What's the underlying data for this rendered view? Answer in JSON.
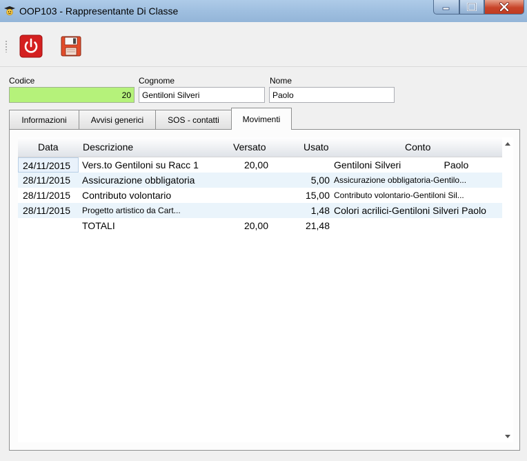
{
  "window": {
    "title": "OOP103 - Rappresentante Di Classe"
  },
  "icons": {
    "app": "graduate-icon",
    "exit": "power-icon",
    "save": "floppy-disk-icon"
  },
  "colors": {
    "codice_bg": "#b5f27a",
    "power_red": "#d42020",
    "row_alt": "#eaf4fb"
  },
  "form": {
    "codice_label": "Codice",
    "codice_value": "20",
    "cognome_label": "Cognome",
    "cognome_value": "Gentiloni Silveri",
    "nome_label": "Nome",
    "nome_value": "Paolo"
  },
  "tabs": [
    {
      "label": "Informazioni"
    },
    {
      "label": "Avvisi generici"
    },
    {
      "label": "SOS - contatti"
    },
    {
      "label": "Movimenti",
      "selected": true
    }
  ],
  "table": {
    "columns": [
      "Data",
      "Descrizione",
      "Versato",
      "Usato",
      "Conto"
    ],
    "rows": [
      {
        "data": "24/11/2015",
        "descrizione": "Vers.to Gentiloni  su Racc 1",
        "versato": "20,00",
        "usato": "",
        "conto": "Gentiloni Silveri                Paolo"
      },
      {
        "data": "28/11/2015",
        "descrizione": "Assicurazione obbligatoria",
        "versato": "",
        "usato": "5,00",
        "conto": "Assicurazione obbligatoria-Gentilo..."
      },
      {
        "data": "28/11/2015",
        "descrizione": "Contributo volontario",
        "versato": "",
        "usato": "15,00",
        "conto": "Contributo volontario-Gentiloni Sil..."
      },
      {
        "data": "28/11/2015",
        "descrizione": "Progetto artistico da Cart...",
        "versato": "",
        "usato": "1,48",
        "conto": "Colori acrilici-Gentiloni Silveri Paolo"
      }
    ],
    "totals": {
      "label": "TOTALI",
      "versato": "20,00",
      "usato": "21,48"
    }
  }
}
